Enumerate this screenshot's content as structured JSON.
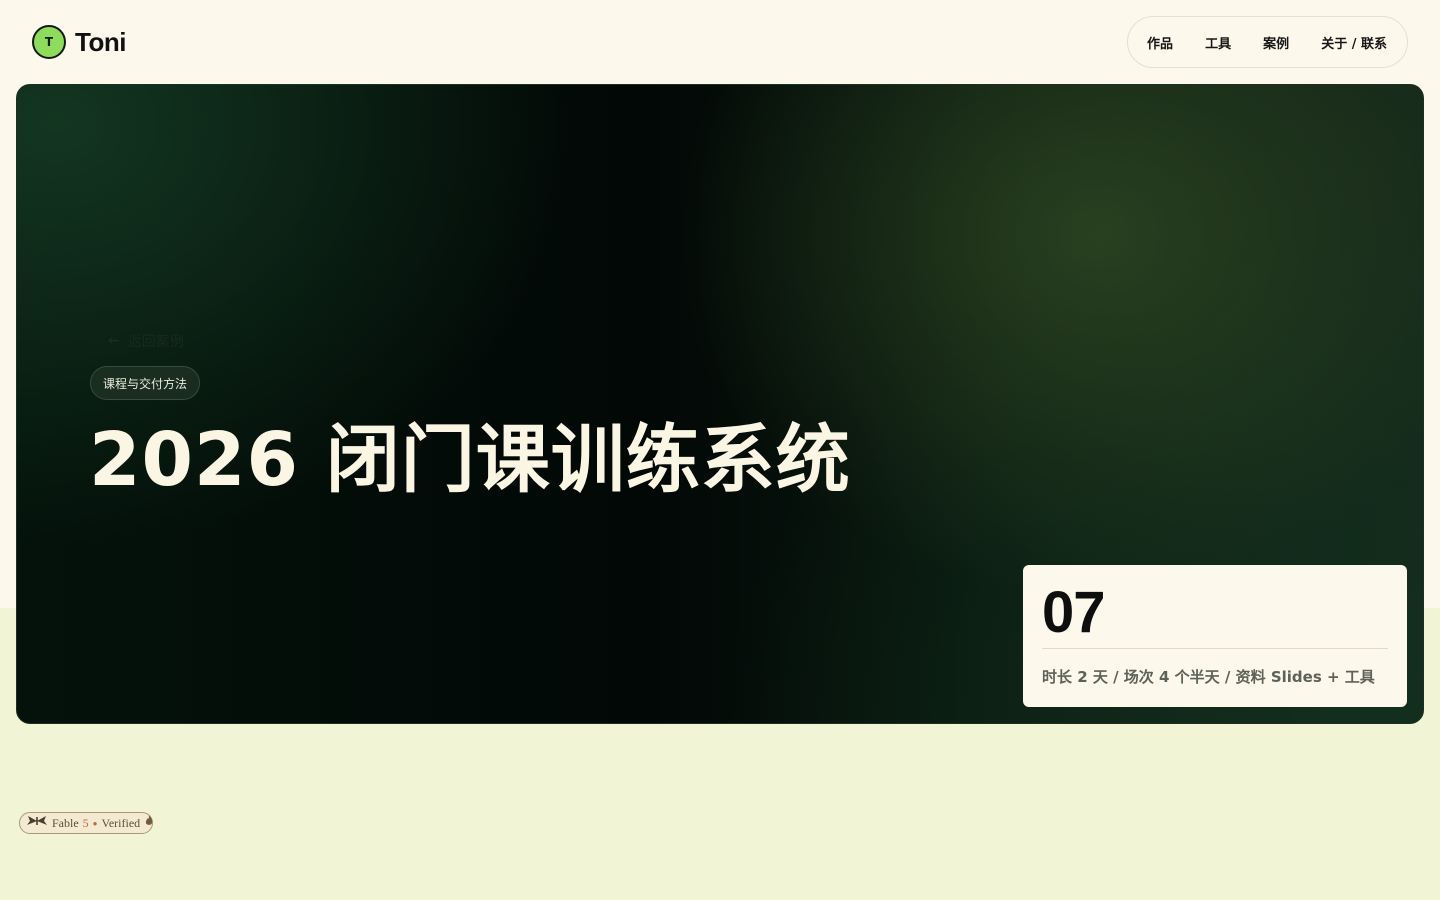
{
  "header": {
    "logo_initial": "T",
    "logo_text": "Toni",
    "nav": [
      {
        "label": "作品"
      },
      {
        "label": "工具"
      },
      {
        "label": "案例"
      },
      {
        "label": "关于 / 联系"
      }
    ]
  },
  "hero": {
    "back_label": "返回案例",
    "tag": "课程与交付方法",
    "title": "2026 闭门课训练系统",
    "stat_number": "07",
    "stat_meta": "时长 2 天 / 场次 4 个半天 / 资料 Slides + 工具"
  },
  "badge": {
    "brand": "Fable",
    "number": "5",
    "label": "Verified"
  },
  "colors": {
    "page_bg": "#fdf8ec",
    "page_bg_lower": "#f1f4d5",
    "accent": "#8fdc5c",
    "hero_dark": "#020806",
    "title_text": "#fbf5e3"
  },
  "icons": [
    "arrow-left-icon",
    "moth-icon",
    "flame-icon"
  ]
}
